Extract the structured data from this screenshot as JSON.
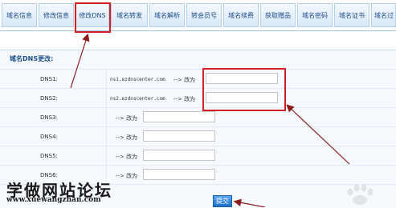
{
  "tabs": [
    {
      "label": "域名信息"
    },
    {
      "label": "修改信息"
    },
    {
      "label": "修改DNS"
    },
    {
      "label": "域名转发"
    },
    {
      "label": "域名解析"
    },
    {
      "label": "转会员号"
    },
    {
      "label": "域名续费"
    },
    {
      "label": "获取赠品"
    },
    {
      "label": "域名密码"
    },
    {
      "label": "域名证书"
    },
    {
      "label": "域名过"
    }
  ],
  "section": {
    "title": "域名DNS更改:"
  },
  "dns_rows": [
    {
      "label": "DNS1:",
      "current": "ns1.ezdnscenter.com",
      "arrow": "--> 改为",
      "value": ""
    },
    {
      "label": "DNS2:",
      "current": "ns2.ezdnscenter.com",
      "arrow": "--> 改为",
      "value": ""
    },
    {
      "label": "DNS3:",
      "current": "",
      "arrow": "--> 改为",
      "value": ""
    },
    {
      "label": "DNS4:",
      "current": "",
      "arrow": "--> 改为",
      "value": ""
    },
    {
      "label": "DNS5:",
      "current": "",
      "arrow": "--> 改为",
      "value": ""
    },
    {
      "label": "DNS6:",
      "current": "",
      "arrow": "--> 改为",
      "value": ""
    }
  ],
  "submit": {
    "label": "提交"
  },
  "watermark": {
    "cn": "学做网站论坛",
    "en": "www.xuewangzhan.com"
  },
  "colors": {
    "highlight": "#d21f26",
    "tab_text": "#1d4f8a"
  }
}
